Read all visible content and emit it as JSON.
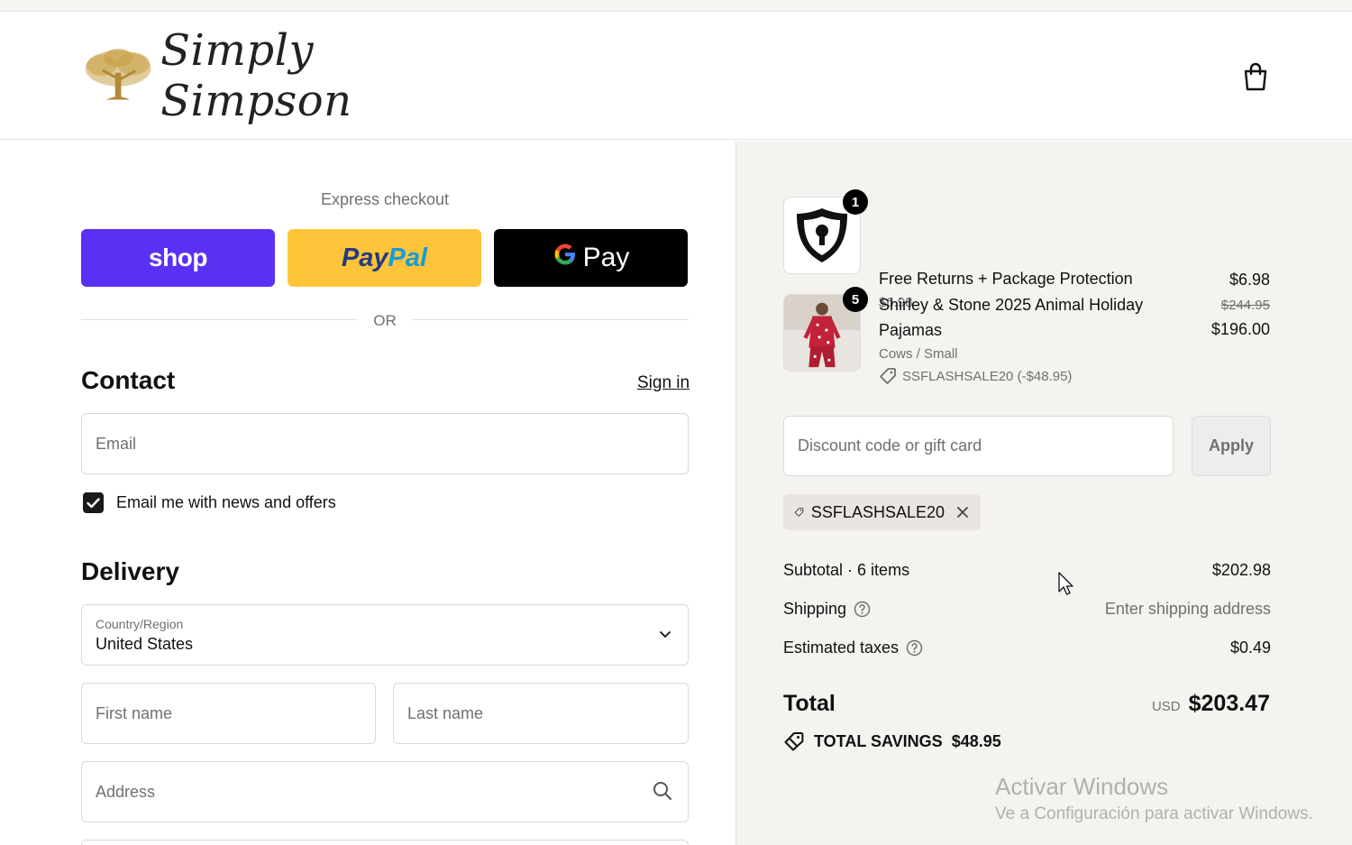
{
  "brand": {
    "name": "Simply Simpson"
  },
  "express": {
    "title": "Express checkout",
    "shop_label": "shop",
    "paypal_part1": "Pay",
    "paypal_part2": "Pal",
    "gpay_g": "G",
    "gpay_label": "Pay",
    "or": "OR"
  },
  "contact": {
    "heading": "Contact",
    "signin": "Sign in",
    "email_placeholder": "Email",
    "newsletter_label": "Email me with news and offers",
    "newsletter_checked": true
  },
  "delivery": {
    "heading": "Delivery",
    "country_label": "Country/Region",
    "country_value": "United States",
    "first_name_placeholder": "First name",
    "last_name_placeholder": "Last name",
    "address_placeholder": "Address"
  },
  "order": {
    "items": [
      {
        "qty": "1",
        "name": "Free Returns + Package Protection",
        "unit": "$6.98",
        "price": "$6.98"
      },
      {
        "qty": "5",
        "name_line1": "Shirley & Stone 2025 Animal Holiday",
        "name_line2": "Pajamas",
        "variant": "Cows / Small",
        "discount": "SSFLASHSALE20 (-$48.95)",
        "original_price": "$244.95",
        "price": "$196.00"
      }
    ],
    "discount_placeholder": "Discount code or gift card",
    "apply": "Apply",
    "applied_code": "SSFLASHSALE20",
    "subtotal_label": "Subtotal · 6 items",
    "subtotal_value": "$202.98",
    "shipping_label": "Shipping",
    "shipping_value": "Enter shipping address",
    "taxes_label": "Estimated taxes",
    "taxes_value": "$0.49",
    "total_label": "Total",
    "currency": "USD",
    "total_value": "$203.47",
    "savings_label": "TOTAL SAVINGS",
    "savings_value": "$48.95"
  },
  "watermark": {
    "line1": "Activar Windows",
    "line2": "Ve a Configuración para activar Windows."
  },
  "colors": {
    "shop_purple": "#5a31f4",
    "paypal_yellow": "#ffc439",
    "gpay_black": "#000000",
    "summary_bg": "#f5f3f0"
  }
}
